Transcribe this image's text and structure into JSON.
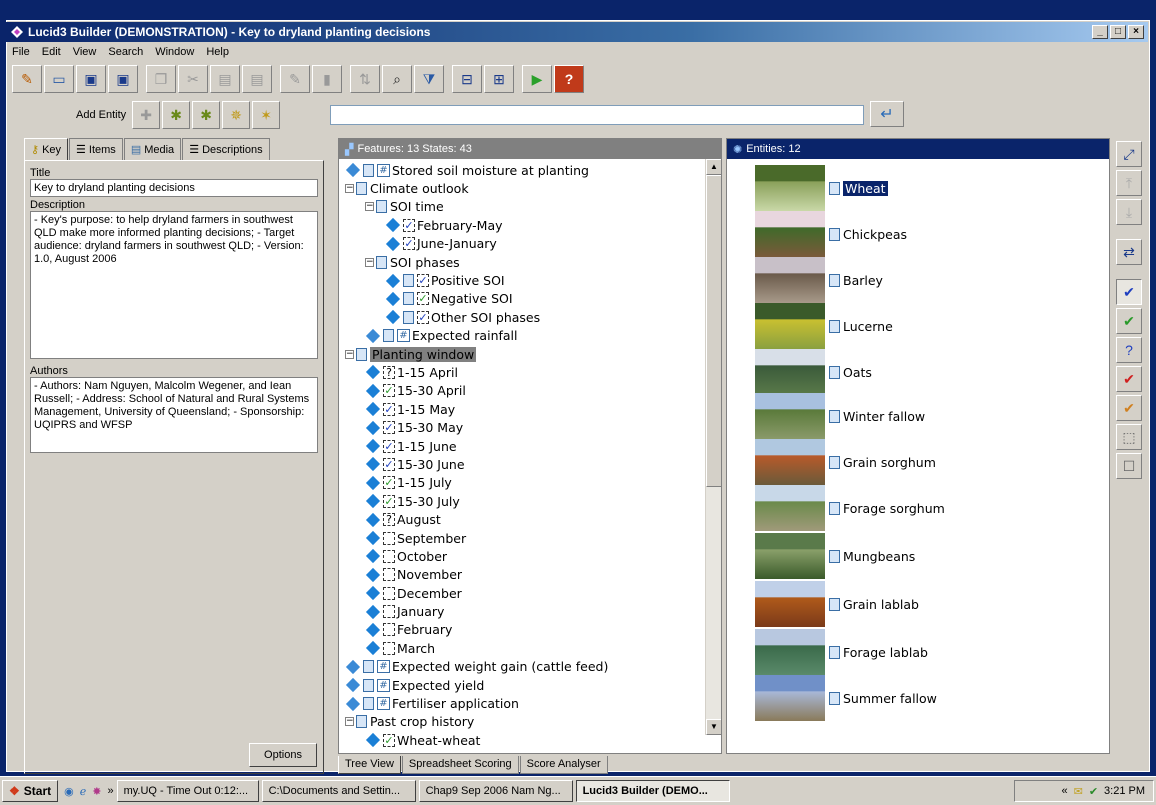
{
  "window": {
    "title": "Lucid3 Builder (DEMONSTRATION) - Key to dryland planting decisions"
  },
  "menu": [
    "File",
    "Edit",
    "View",
    "Search",
    "Window",
    "Help"
  ],
  "entitybar": {
    "label": "Add Entity"
  },
  "leftpanel": {
    "tabs": [
      "Key",
      "Items",
      "Media",
      "Descriptions"
    ],
    "title_label": "Title",
    "title_value": "Key to dryland planting decisions",
    "description_label": "Description",
    "description_value": "- Key's purpose: to help dryland farmers in southwest QLD make more informed planting decisions; - Target audience: dryland farmers in southwest QLD; - Version: 1.0, August 2006",
    "authors_label": "Authors",
    "authors_value": "- Authors: Nam Nguyen, Malcolm Wegener, and Iean Russell; - Address: School of Natural and Rural Systems Management, University of Queensland; - Sponsorship: UQIPRS and WFSP",
    "options_label": "Options"
  },
  "features": {
    "header": "Features: 13 States: 43",
    "nodes": [
      {
        "label": "Stored soil moisture at planting",
        "kind": "numeric",
        "depth": 0
      },
      {
        "label": "Climate outlook",
        "kind": "group",
        "depth": 0
      },
      {
        "label": "SOI time",
        "kind": "group",
        "depth": 1
      },
      {
        "label": "February-May",
        "kind": "state",
        "check": "blue",
        "depth": 2
      },
      {
        "label": "June-January",
        "kind": "state",
        "check": "blue",
        "depth": 2
      },
      {
        "label": "SOI phases",
        "kind": "group",
        "depth": 1
      },
      {
        "label": "Positive SOI",
        "kind": "statedoc",
        "check": "blue",
        "depth": 2
      },
      {
        "label": "Negative SOI",
        "kind": "statedoc",
        "check": "green",
        "depth": 2
      },
      {
        "label": "Other SOI phases",
        "kind": "statedoc",
        "check": "blue",
        "depth": 2
      },
      {
        "label": "Expected rainfall",
        "kind": "numeric",
        "depth": 1
      },
      {
        "label": "Planting window",
        "kind": "group",
        "depth": 0,
        "selected": true
      },
      {
        "label": "1-15 April",
        "kind": "state",
        "check": "q",
        "depth": 1
      },
      {
        "label": "15-30 April",
        "kind": "state",
        "check": "green",
        "depth": 1
      },
      {
        "label": "1-15 May",
        "kind": "state",
        "check": "blue",
        "depth": 1
      },
      {
        "label": "15-30 May",
        "kind": "state",
        "check": "blue",
        "depth": 1
      },
      {
        "label": "1-15 June",
        "kind": "state",
        "check": "blue",
        "depth": 1
      },
      {
        "label": "15-30 June",
        "kind": "state",
        "check": "blue",
        "depth": 1
      },
      {
        "label": "1-15 July",
        "kind": "state",
        "check": "green",
        "depth": 1
      },
      {
        "label": "15-30 July",
        "kind": "state",
        "check": "green",
        "depth": 1
      },
      {
        "label": "August",
        "kind": "state",
        "check": "q",
        "depth": 1
      },
      {
        "label": "September",
        "kind": "state",
        "check": "none",
        "depth": 1
      },
      {
        "label": "October",
        "kind": "state",
        "check": "none",
        "depth": 1
      },
      {
        "label": "November",
        "kind": "state",
        "check": "none",
        "depth": 1
      },
      {
        "label": "December",
        "kind": "state",
        "check": "none",
        "depth": 1
      },
      {
        "label": "January",
        "kind": "state",
        "check": "none",
        "depth": 1
      },
      {
        "label": "February",
        "kind": "state",
        "check": "none",
        "depth": 1
      },
      {
        "label": "March",
        "kind": "state",
        "check": "none",
        "depth": 1
      },
      {
        "label": "Expected weight gain (cattle feed)",
        "kind": "numeric",
        "depth": 0
      },
      {
        "label": "Expected yield",
        "kind": "numeric",
        "depth": 0
      },
      {
        "label": "Fertiliser application",
        "kind": "numeric",
        "depth": 0
      },
      {
        "label": "Past crop history",
        "kind": "group",
        "depth": 0
      },
      {
        "label": "Wheat-wheat",
        "kind": "state",
        "check": "green",
        "depth": 1
      }
    ]
  },
  "bottomtabs": [
    "Tree View",
    "Spreadsheet Scoring",
    "Score Analyser"
  ],
  "entities": {
    "header": "Entities: 12",
    "items": [
      {
        "label": "Wheat",
        "colors": [
          "#4a6a2a",
          "#8aa05a",
          "#c9d8a8"
        ],
        "selected": true
      },
      {
        "label": "Chickpeas",
        "colors": [
          "#e8d6de",
          "#3f6a2a",
          "#7a5a3a"
        ]
      },
      {
        "label": "Barley",
        "colors": [
          "#c8c0c8",
          "#6a5a4a",
          "#a89a8a"
        ]
      },
      {
        "label": "Lucerne",
        "colors": [
          "#3a5a2a",
          "#c9c030",
          "#8aa040"
        ]
      },
      {
        "label": "Oats",
        "colors": [
          "#d8dfe8",
          "#3a5a3a",
          "#5a7a4a"
        ]
      },
      {
        "label": "Winter fallow",
        "colors": [
          "#a8c0e0",
          "#5a7a3a",
          "#8a9a6a"
        ]
      },
      {
        "label": "Grain sorghum",
        "colors": [
          "#b0c8e0",
          "#b85a2a",
          "#6a5a3a"
        ]
      },
      {
        "label": "Forage sorghum",
        "colors": [
          "#c8d8e8",
          "#6a8a4a",
          "#a09a7a"
        ]
      },
      {
        "label": "Mungbeans",
        "colors": [
          "#5a7a4a",
          "#8aa06a",
          "#3a5a2a"
        ]
      },
      {
        "label": "Grain lablab",
        "colors": [
          "#c0d0e8",
          "#b05a1a",
          "#7a3a1a"
        ]
      },
      {
        "label": "Forage lablab",
        "colors": [
          "#b8c8e0",
          "#3a6a4a",
          "#5a8a6a"
        ]
      },
      {
        "label": "Summer fallow",
        "colors": [
          "#7090c8",
          "#a8b8d8",
          "#8a7a5a"
        ]
      }
    ]
  },
  "taskbar": {
    "start": "Start",
    "tasks": [
      "my.UQ - Time Out 0:12:...",
      "C:\\Documents and Settin...",
      "Chap9 Sep 2006 Nam Ng...",
      "Lucid3 Builder (DEMO..."
    ],
    "clock": "3:21 PM"
  },
  "colors": {
    "titlebar": "#0a246a",
    "face": "#d4d0c8",
    "state_diamond": "#1a7fd6"
  }
}
